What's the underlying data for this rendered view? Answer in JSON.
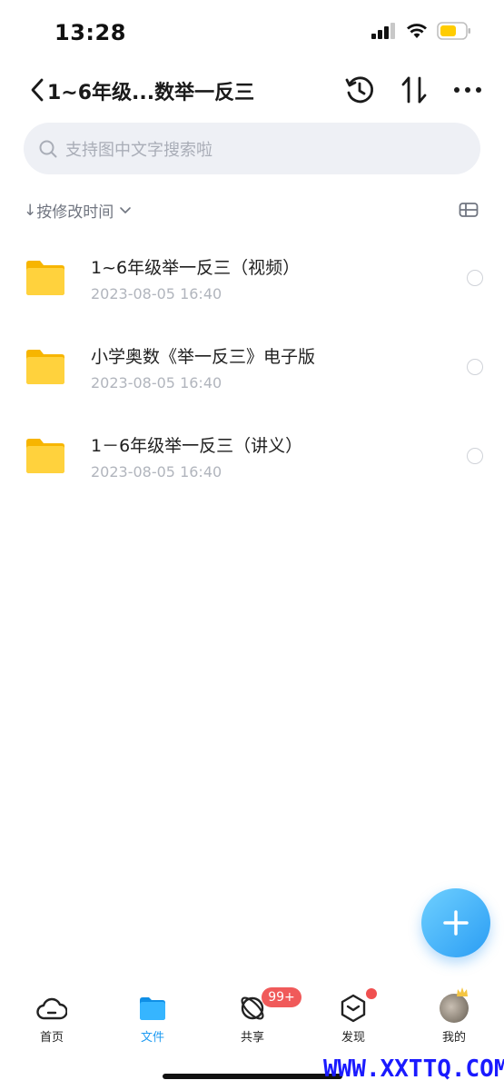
{
  "status": {
    "time": "13:28"
  },
  "nav": {
    "title": "1~6年级...数举一反三"
  },
  "search": {
    "placeholder": "支持图中文字搜索啦"
  },
  "sort": {
    "label": "按修改时间",
    "arrow": "↓"
  },
  "files": [
    {
      "name": "1~6年级举一反三（视频）",
      "date": "2023-08-05 16:40"
    },
    {
      "name": "小学奥数《举一反三》电子版",
      "date": "2023-08-05 16:40"
    },
    {
      "name": "1－6年级举一反三（讲义）",
      "date": "2023-08-05 16:40"
    }
  ],
  "tabs": {
    "home": "首页",
    "files": "文件",
    "share": "共享",
    "discover": "发现",
    "mine": "我的"
  },
  "badge": "99+",
  "watermark": "WWW.XXTTQ.COM",
  "colors": {
    "accent": "#1e9bf2",
    "folder": "#ffc629",
    "badge": "#f05a5a"
  }
}
